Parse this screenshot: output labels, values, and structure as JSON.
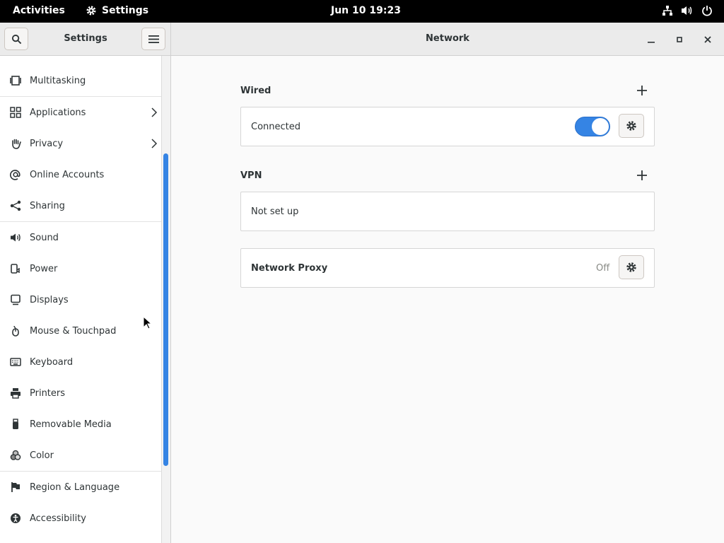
{
  "topbar": {
    "activities": "Activities",
    "app_name": "Settings",
    "clock": "Jun 10  19:23"
  },
  "header": {
    "sidebar_title": "Settings",
    "main_title": "Network"
  },
  "sidebar": {
    "items": [
      {
        "label": "Multitasking",
        "icon": "multitasking-icon"
      },
      {
        "label": "Applications",
        "icon": "applications-icon",
        "has_submenu": true
      },
      {
        "label": "Privacy",
        "icon": "privacy-hand-icon",
        "has_submenu": true
      },
      {
        "label": "Online Accounts",
        "icon": "at-icon"
      },
      {
        "label": "Sharing",
        "icon": "share-icon"
      },
      {
        "label": "Sound",
        "icon": "speaker-icon"
      },
      {
        "label": "Power",
        "icon": "power-plug-icon"
      },
      {
        "label": "Displays",
        "icon": "display-icon"
      },
      {
        "label": "Mouse & Touchpad",
        "icon": "mouse-icon"
      },
      {
        "label": "Keyboard",
        "icon": "keyboard-icon"
      },
      {
        "label": "Printers",
        "icon": "printer-icon"
      },
      {
        "label": "Removable Media",
        "icon": "usb-drive-icon"
      },
      {
        "label": "Color",
        "icon": "color-icon"
      },
      {
        "label": "Region & Language",
        "icon": "flag-icon"
      },
      {
        "label": "Accessibility",
        "icon": "accessibility-icon"
      }
    ]
  },
  "network": {
    "wired": {
      "title": "Wired",
      "status": "Connected",
      "enabled": true
    },
    "vpn": {
      "title": "VPN",
      "status": "Not set up"
    },
    "proxy": {
      "label": "Network Proxy",
      "status": "Off"
    }
  },
  "colors": {
    "accent": "#3584e4",
    "topbar": "#000000",
    "text": "#2e3436"
  }
}
